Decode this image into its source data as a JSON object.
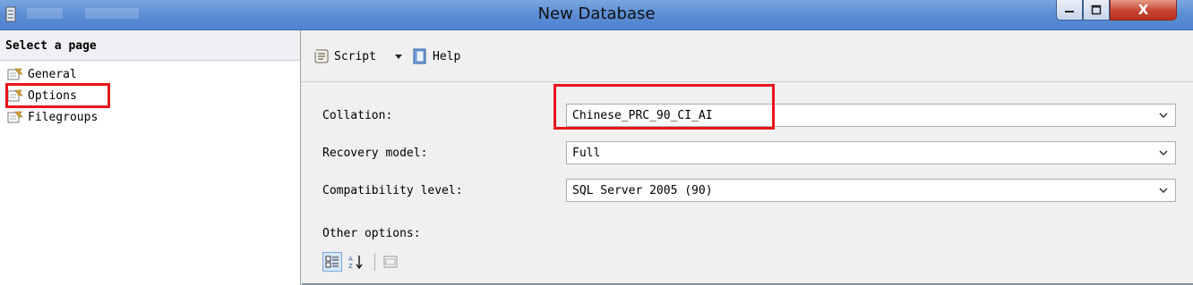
{
  "window": {
    "title": "New Database",
    "min_glyph": "–",
    "max_glyph": "□",
    "close_glyph": "X"
  },
  "left": {
    "header": "Select a page",
    "pages": [
      {
        "label": "General",
        "icon": "wrench-page-icon"
      },
      {
        "label": "Options",
        "icon": "wrench-page-icon",
        "selected": true
      },
      {
        "label": "Filegroups",
        "icon": "wrench-page-icon"
      }
    ]
  },
  "toolbar": {
    "script_label": "Script",
    "help_label": "Help"
  },
  "form": {
    "collation_label": "Collation:",
    "collation_value": "Chinese_PRC_90_CI_AI",
    "recovery_label": "Recovery model:",
    "recovery_value": "Full",
    "compat_label": "Compatibility level:",
    "compat_value": "SQL Server 2005 (90)",
    "other_label": "Other options:"
  },
  "colors": {
    "highlight": "#e8151b",
    "titlebar": "#5d8fd6"
  }
}
